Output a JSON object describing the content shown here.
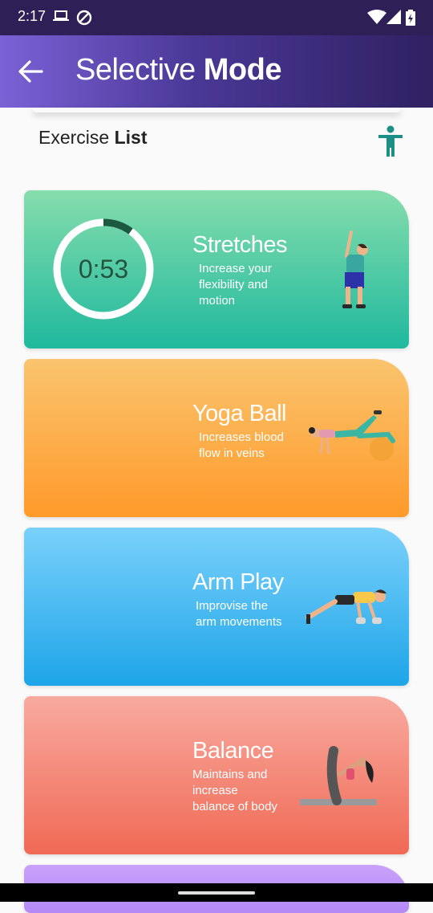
{
  "status_bar": {
    "time": "2:17",
    "icons": [
      "laptop-icon",
      "sync-off-icon",
      "wifi-icon",
      "signal-icon",
      "battery-charging-icon"
    ]
  },
  "app_bar": {
    "title_light": "Selective ",
    "title_bold": "Mode",
    "back_icon": "arrow-back-icon",
    "gradient": [
      "#7a62d6",
      "#2f2162"
    ]
  },
  "section": {
    "title_light": "Exercise ",
    "title_bold": "List",
    "action_icon": "accessibility-person-icon",
    "icon_color": "#1c8f86"
  },
  "cards": [
    {
      "title": "Stretches",
      "description": "Increase your flexibility and motion",
      "gradient": [
        "#86ddad",
        "#1fb99d"
      ],
      "timer": "0:53",
      "timer_progress": 0.1,
      "illustration": "stretching-man-illustration"
    },
    {
      "title": "Yoga Ball",
      "description": "Increases blood flow in veins",
      "gradient": [
        "#fac46e",
        "#ff9a2a"
      ],
      "illustration": "yoga-ball-woman-illustration"
    },
    {
      "title": "Arm Play",
      "description": "Improvise the arm movements",
      "gradient": [
        "#7ad1fb",
        "#1ea5e8"
      ],
      "illustration": "pushup-man-illustration"
    },
    {
      "title": "Balance",
      "description": "Maintains and increase balance of body",
      "gradient": [
        "#f8aa9f",
        "#f06a55"
      ],
      "illustration": "balance-woman-illustration"
    },
    {
      "title": "",
      "description": "",
      "gradient": [
        "#c8a2fb",
        "#b48af6"
      ]
    }
  ]
}
